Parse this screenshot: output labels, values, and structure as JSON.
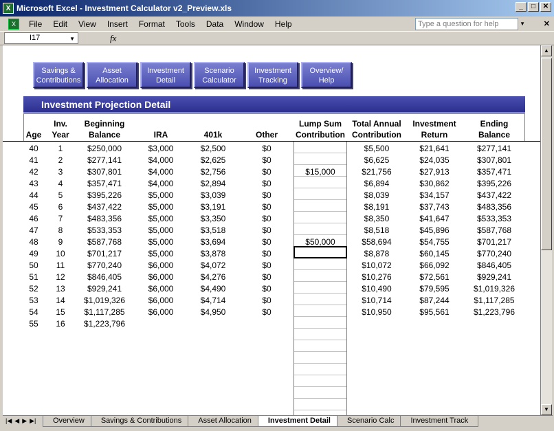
{
  "window": {
    "title": "Microsoft Excel - Investment Calculator v2_Preview.xls"
  },
  "menu": [
    "File",
    "Edit",
    "View",
    "Insert",
    "Format",
    "Tools",
    "Data",
    "Window",
    "Help"
  ],
  "help_placeholder": "Type a question for help",
  "name_box": "I17",
  "fx_label": "fx",
  "nav_buttons": [
    {
      "line1": "Savings &",
      "line2": "Contributions"
    },
    {
      "line1": "Asset",
      "line2": "Allocation"
    },
    {
      "line1": "Investment",
      "line2": "Detail"
    },
    {
      "line1": "Scenario",
      "line2": "Calculator"
    },
    {
      "line1": "Investment",
      "line2": "Tracking"
    },
    {
      "line1": "Overview/",
      "line2": "Help"
    }
  ],
  "banner": "Investment Projection Detail",
  "headers": {
    "age": "Age",
    "inv_year_1": "Inv.",
    "inv_year_2": "Year",
    "beg_1": "Beginning",
    "beg_2": "Balance",
    "ira": "IRA",
    "k401": "401k",
    "other": "Other",
    "lump_1": "Lump Sum",
    "lump_2": "Contribution",
    "tac_1": "Total Annual",
    "tac_2": "Contribution",
    "ir_1": "Investment",
    "ir_2": "Return",
    "eb_1": "Ending",
    "eb_2": "Balance"
  },
  "rows": [
    [
      "40",
      "1",
      "$250,000",
      "$3,000",
      "$2,500",
      "$0",
      "",
      "$5,500",
      "$21,641",
      "$277,141"
    ],
    [
      "41",
      "2",
      "$277,141",
      "$4,000",
      "$2,625",
      "$0",
      "",
      "$6,625",
      "$24,035",
      "$307,801"
    ],
    [
      "42",
      "3",
      "$307,801",
      "$4,000",
      "$2,756",
      "$0",
      "$15,000",
      "$21,756",
      "$27,913",
      "$357,471"
    ],
    [
      "43",
      "4",
      "$357,471",
      "$4,000",
      "$2,894",
      "$0",
      "",
      "$6,894",
      "$30,862",
      "$395,226"
    ],
    [
      "44",
      "5",
      "$395,226",
      "$5,000",
      "$3,039",
      "$0",
      "",
      "$8,039",
      "$34,157",
      "$437,422"
    ],
    [
      "45",
      "6",
      "$437,422",
      "$5,000",
      "$3,191",
      "$0",
      "",
      "$8,191",
      "$37,743",
      "$483,356"
    ],
    [
      "46",
      "7",
      "$483,356",
      "$5,000",
      "$3,350",
      "$0",
      "",
      "$8,350",
      "$41,647",
      "$533,353"
    ],
    [
      "47",
      "8",
      "$533,353",
      "$5,000",
      "$3,518",
      "$0",
      "",
      "$8,518",
      "$45,896",
      "$587,768"
    ],
    [
      "48",
      "9",
      "$587,768",
      "$5,000",
      "$3,694",
      "$0",
      "$50,000",
      "$58,694",
      "$54,755",
      "$701,217"
    ],
    [
      "49",
      "10",
      "$701,217",
      "$5,000",
      "$3,878",
      "$0",
      "",
      "$8,878",
      "$60,145",
      "$770,240"
    ],
    [
      "50",
      "11",
      "$770,240",
      "$6,000",
      "$4,072",
      "$0",
      "",
      "$10,072",
      "$66,092",
      "$846,405"
    ],
    [
      "51",
      "12",
      "$846,405",
      "$6,000",
      "$4,276",
      "$0",
      "",
      "$10,276",
      "$72,561",
      "$929,241"
    ],
    [
      "52",
      "13",
      "$929,241",
      "$6,000",
      "$4,490",
      "$0",
      "",
      "$10,490",
      "$79,595",
      "$1,019,326"
    ],
    [
      "53",
      "14",
      "$1,019,326",
      "$6,000",
      "$4,714",
      "$0",
      "",
      "$10,714",
      "$87,244",
      "$1,117,285"
    ],
    [
      "54",
      "15",
      "$1,117,285",
      "$6,000",
      "$4,950",
      "$0",
      "",
      "$10,950",
      "$95,561",
      "$1,223,796"
    ],
    [
      "55",
      "16",
      "$1,223,796",
      "",
      "",
      "",
      "",
      "",
      "",
      ""
    ]
  ],
  "tabs": [
    "Overview",
    "Savings & Contributions",
    "Asset Allocation",
    "Investment Detail",
    "Scenario Calc",
    "Investment Track"
  ],
  "active_tab": "Investment Detail"
}
